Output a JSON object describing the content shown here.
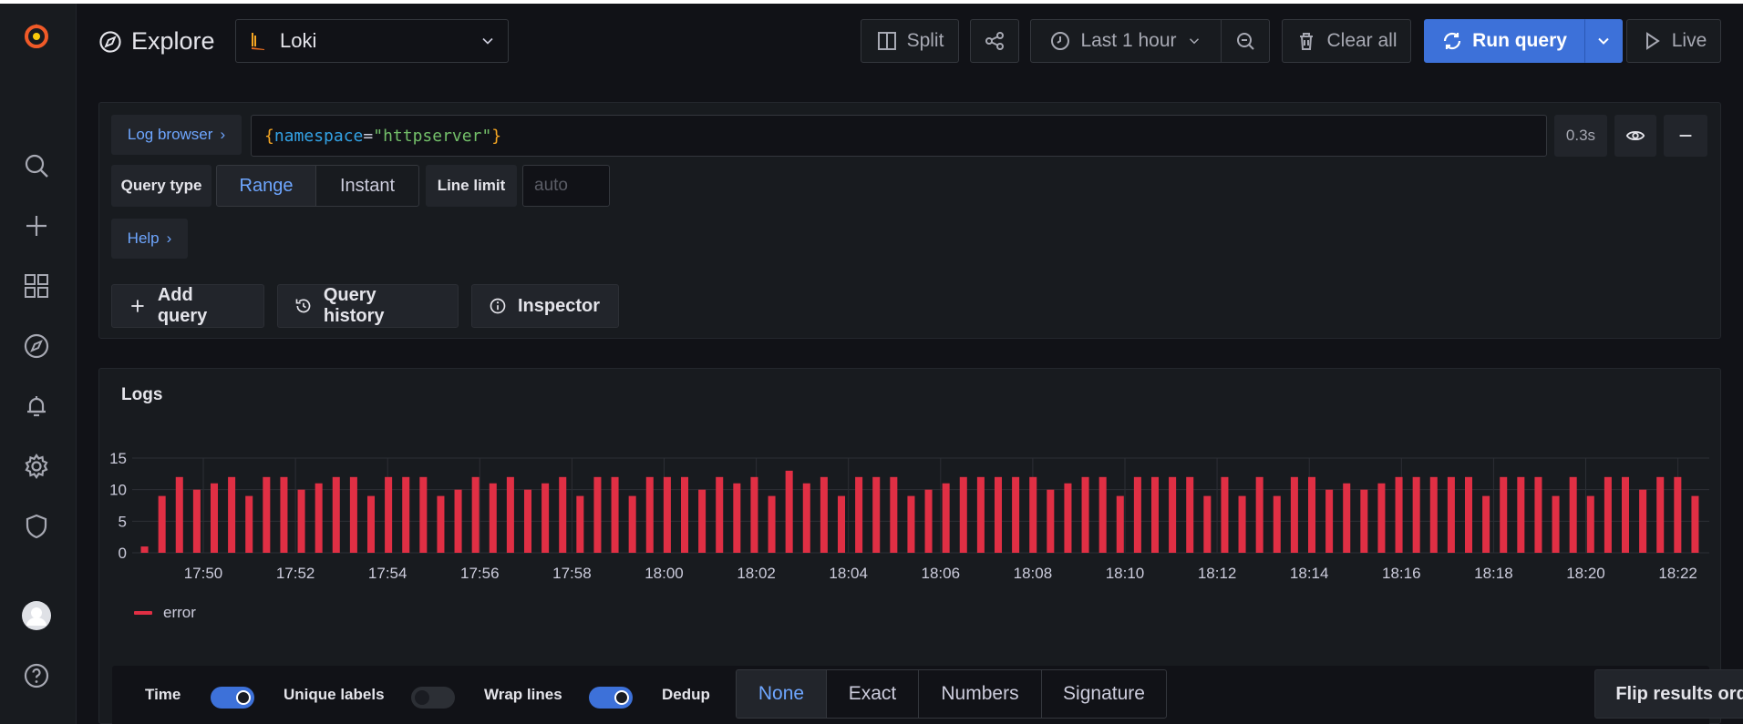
{
  "page": {
    "title": "Explore"
  },
  "datasource": {
    "name": "Loki"
  },
  "toolbar": {
    "split_label": "Split",
    "time_range": "Last 1 hour",
    "clear_label": "Clear all",
    "run_label": "Run query",
    "live_label": "Live"
  },
  "query": {
    "log_browser_label": "Log browser",
    "expression_key": "namespace",
    "expression_value": "\"httpserver\"",
    "query_time": "0.3s",
    "query_type_label": "Query type",
    "query_types": [
      "Range",
      "Instant"
    ],
    "active_query_type": "Range",
    "line_limit_label": "Line limit",
    "line_limit_placeholder": "auto",
    "help_label": "Help"
  },
  "actions": {
    "add_query": "Add query",
    "query_history": "Query history",
    "inspector": "Inspector"
  },
  "logs": {
    "title": "Logs",
    "options": {
      "time_label": "Time",
      "time_on": true,
      "unique_labels_label": "Unique labels",
      "unique_labels_on": false,
      "wrap_lines_label": "Wrap lines",
      "wrap_lines_on": true,
      "dedup_label": "Dedup",
      "dedup_modes": [
        "None",
        "Exact",
        "Numbers",
        "Signature"
      ],
      "active_dedup": "None",
      "flip_label": "Flip results order"
    }
  },
  "colors": {
    "accent": "#3d71d9",
    "series": "#e02f44",
    "background": "#111217",
    "panel": "#181b1f"
  },
  "chart_data": {
    "type": "bar",
    "x_ticks": [
      "17:50",
      "17:52",
      "17:54",
      "17:56",
      "17:58",
      "18:00",
      "18:02",
      "18:04",
      "18:06",
      "18:08",
      "18:10",
      "18:12",
      "18:14",
      "18:16",
      "18:18",
      "18:20",
      "18:22"
    ],
    "y_ticks": [
      0,
      5,
      10,
      15
    ],
    "ylim": [
      0,
      15
    ],
    "series": [
      {
        "name": "error",
        "color": "#e02f44",
        "values": [
          1,
          9,
          12,
          10,
          11,
          12,
          9,
          12,
          12,
          10,
          11,
          12,
          12,
          9,
          12,
          12,
          12,
          9,
          10,
          12,
          11,
          12,
          10,
          11,
          12,
          9,
          12,
          12,
          9,
          12,
          12,
          12,
          10,
          12,
          11,
          12,
          9,
          13,
          11,
          12,
          9,
          12,
          12,
          12,
          9,
          10,
          11,
          12,
          12,
          12,
          12,
          12,
          10,
          11,
          12,
          12,
          9,
          12,
          12,
          12,
          12,
          9,
          12,
          9,
          12,
          9,
          12,
          12,
          10,
          11,
          10,
          11,
          12,
          12,
          12,
          12,
          12,
          9,
          12,
          12,
          12,
          9,
          12,
          9,
          12,
          12,
          10,
          12,
          12,
          9
        ]
      }
    ],
    "legend_position": "bottom-left",
    "grid": true
  }
}
